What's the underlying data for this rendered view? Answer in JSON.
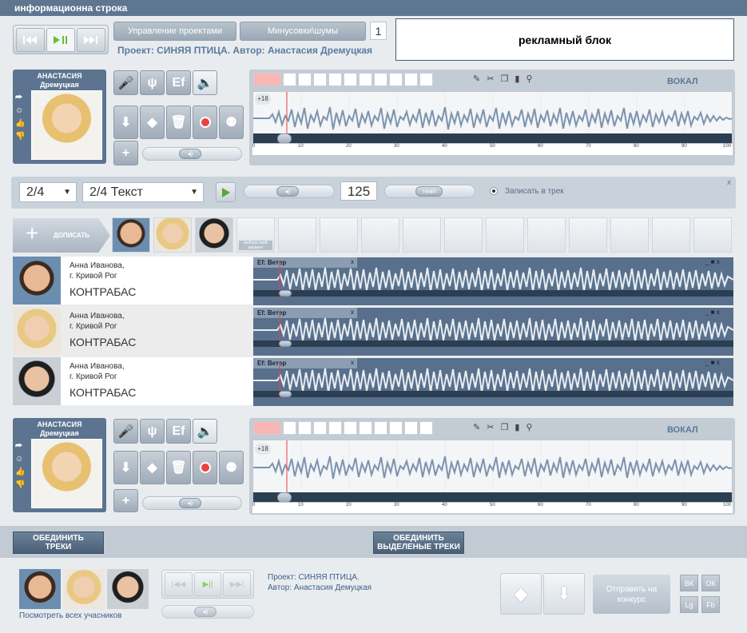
{
  "topbar": {
    "title": "информационна строка"
  },
  "transport": {
    "track_number": "1"
  },
  "project": {
    "manage_label": "Управление проектами",
    "minus_label": "Минусовки\\шумы",
    "line": "Проект: СИНЯЯ ПТИЦА. Автор: Анастасия Дремуцкая"
  },
  "ad": {
    "label": "рекламный блок"
  },
  "vocal_panel": {
    "singer_name_1": "АНАСТАСИЯ",
    "singer_name_2": "Дремуцкая",
    "fx_label": "Ef",
    "track_label": "ВОКАЛ",
    "level_label": "+18"
  },
  "ruler": {
    "ticks": [
      "0",
      "10",
      "20",
      "30",
      "40",
      "50",
      "60",
      "70",
      "80",
      "90",
      "100"
    ]
  },
  "controls": {
    "time_sig": "2/4",
    "text_select": "2/4  Текст",
    "tempo": "125",
    "tempo_label": "темп",
    "record_label": "Записать в трек",
    "close": "x"
  },
  "add": {
    "label": "ДОПИСАТЬ"
  },
  "avatar_hint": "выбери свой вариант",
  "tracks": [
    {
      "name_1": "Анна Иванова,",
      "name_2": "г. Кривой Рог",
      "instrument": "КОНТРАБАС",
      "fx": "Ef:",
      "effect": "Ветер"
    },
    {
      "name_1": "Анна Иванова,",
      "name_2": "г. Кривой Рог",
      "instrument": "КОНТРАБАС",
      "fx": "Ef:",
      "effect": "Ветер"
    },
    {
      "name_1": "Анна Иванова,",
      "name_2": "г. Кривой Рог",
      "instrument": "КОНТРАБАС",
      "fx": "Ef:",
      "effect": "Ветер"
    }
  ],
  "merge": {
    "merge_tracks": "ОБЕДИНИТЬ ТРЕКИ",
    "merge_selected": "ОБЕДИНИТЬ ВЫДЕЛЕНЫЕ ТРЕКИ"
  },
  "footer": {
    "see_all": "Посмотреть всех учасников",
    "project": "Проект: СИНЯЯ ПТИЦА.",
    "author": "Автор: Анастасия Демуцкая",
    "send": "Отправить на конкурс",
    "social": [
      "ВК",
      "ОК",
      "Lg",
      "Fb"
    ]
  },
  "colors": {
    "accent": "#5c7490",
    "record": "#e8433f",
    "play_green": "#5aa832"
  }
}
